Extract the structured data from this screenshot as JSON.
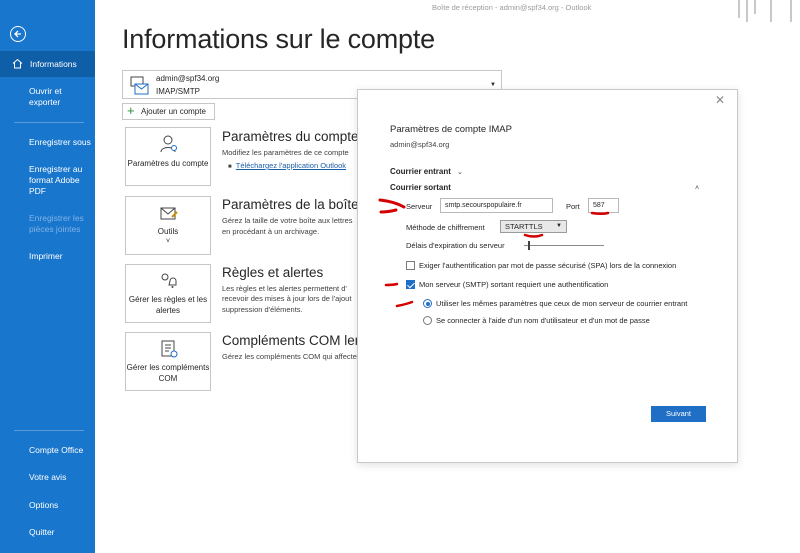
{
  "window": {
    "title": "Boîte de réception - admin@spf34.org  -  Outlook"
  },
  "nav": {
    "items": [
      {
        "label": "Informations"
      },
      {
        "label": "Ouvrir et exporter"
      },
      {
        "label": "Enregistrer sous"
      },
      {
        "label": "Enregistrer au format Adobe PDF"
      },
      {
        "label": "Enregistrer les pièces jointes"
      },
      {
        "label": "Imprimer"
      },
      {
        "label": "Compte Office"
      },
      {
        "label": "Votre avis"
      },
      {
        "label": "Options"
      },
      {
        "label": "Quitter"
      }
    ]
  },
  "main": {
    "title": "Informations sur le compte",
    "account": {
      "email": "admin@spf34.org",
      "type": "IMAP/SMTP"
    },
    "add_account_label": "Ajouter un compte",
    "sections": [
      {
        "tile_label": "Paramètres du compte",
        "tile_suffix": "˅",
        "title": "Paramètres du compte",
        "desc": "Modifiez les paramètres de ce compte",
        "link": "Téléchargez l'application Outlook"
      },
      {
        "tile_label": "Outils",
        "tile_suffix": "˅",
        "title": "Paramètres de la boîte aux",
        "desc1": "Gérez la taille de votre boîte aux lettres",
        "desc2": "en procédant à un archivage."
      },
      {
        "tile_label": "Gérer les règles et les alertes",
        "title": "Règles et alertes",
        "desc1": "Les règles et les alertes permettent d'",
        "desc2": "recevoir des mises à jour lors de l'ajout",
        "desc3": "suppression d'éléments."
      },
      {
        "tile_label": "Gérer les compléments COM",
        "title": "Compléments COM lents",
        "desc1": "Gérez les compléments COM qui affectent"
      }
    ]
  },
  "dialog": {
    "close": "✕",
    "title": "Paramètres de compte IMAP",
    "email": "admin@spf34.org",
    "incoming_label": "Courrier entrant",
    "outgoing_label": "Courrier sortant",
    "server_label": "Serveur",
    "server_value": "smtp.secourspopulaire.fr",
    "port_label": "Port",
    "port_value": "587",
    "encryption_label": "Méthode de chiffrement",
    "encryption_value": "STARTTLS",
    "timeout_label": "Délais d'expiration du serveur",
    "timeout_level": 0.05,
    "spa_label": "Exiger l'authentification par mot de passe sécurisé (SPA) lors de la connexion",
    "spa_checked": false,
    "smtp_auth_label": "Mon serveur (SMTP) sortant requiert une authentification",
    "smtp_auth_checked": true,
    "radio_same_label": "Utiliser les mêmes paramètres que ceux de mon serveur de courrier entrant",
    "radio_login_label": "Se connecter à l'aide d'un nom d'utilisateur et d'un mot de passe",
    "next_button": "Suivant"
  },
  "colors": {
    "nav_bg": "#1976cd",
    "nav_active": "#0f5ea8",
    "accent": "#1f6fc6",
    "annotation": "#d40000"
  }
}
